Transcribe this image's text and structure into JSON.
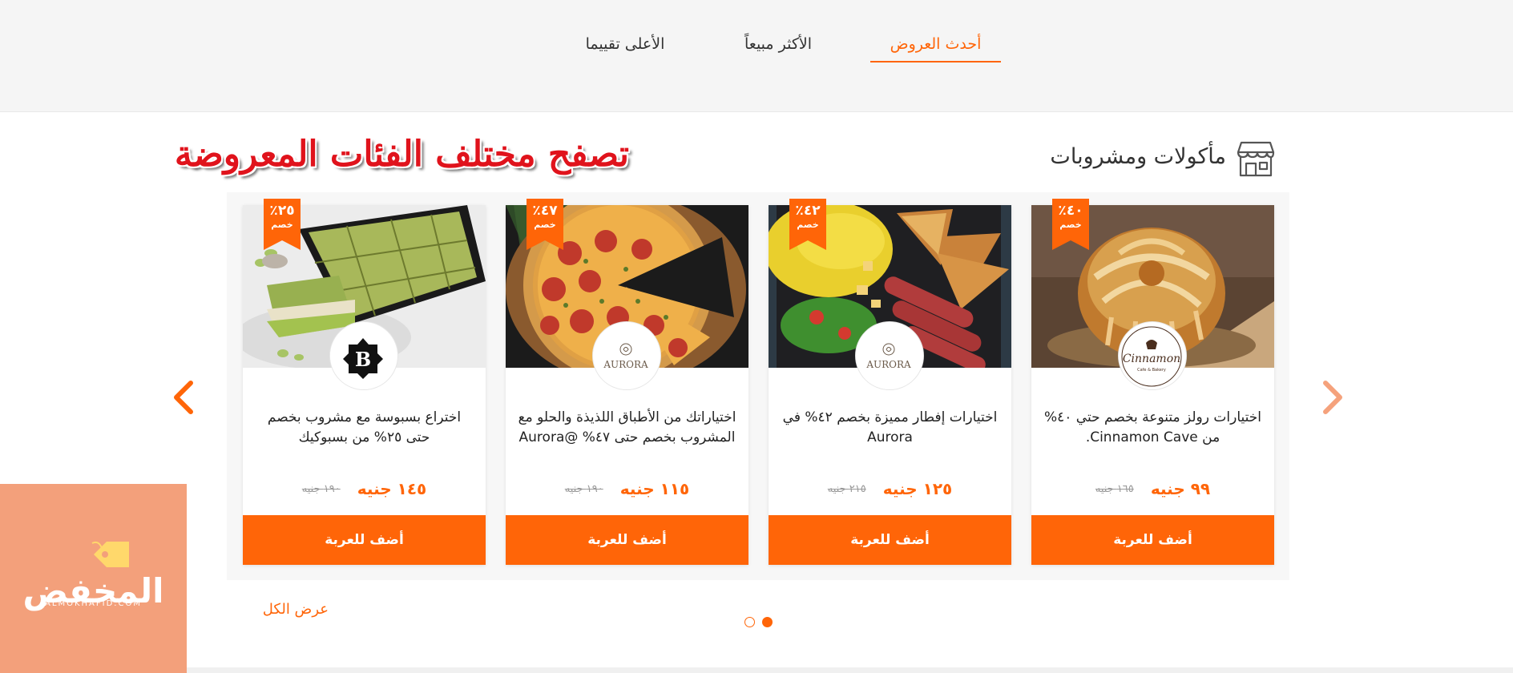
{
  "tabs": [
    {
      "label": "أحدث العروض",
      "active": true
    },
    {
      "label": "الأكثر مبيعاً",
      "active": false
    },
    {
      "label": "الأعلى تقييما",
      "active": false
    }
  ],
  "section": {
    "title": "مأكولات ومشروبات",
    "icon": "store-icon"
  },
  "promo_heading": "تصفح مختلف الفئات المعروضة",
  "badge_word": "خصم",
  "add_to_cart_label": "أضف للعربة",
  "cards": [
    {
      "title": "اختيارات رولز متنوعة بخصم حتي ٤٠% من Cinnamon Cave.",
      "discount": "٤٠٪",
      "price_new": "٩٩ جنيه",
      "price_old": "١٦٥ جنيه",
      "brand": "Cinnamon Cave",
      "brand_logo_text": "Cinnamon",
      "brand_logo_sub": "Cafe & Bakery",
      "image": "cinnamon-roll"
    },
    {
      "title": "اختيارات إفطار مميزة بخصم ٤٢% في Aurora",
      "discount": "٤٢٪",
      "price_new": "١٢٥ جنيه",
      "price_old": "٢١٥ جنيه",
      "brand": "Aurora",
      "brand_logo_text": "AURORA",
      "image": "breakfast-plate"
    },
    {
      "title": "اختياراتك من الأطباق اللذيذة والحلو مع المشروب بخصم حتى ٤٧% @Aurora",
      "discount": "٤٧٪",
      "price_new": "١١٥ جنيه",
      "price_old": "١٩٠ جنيه",
      "brand": "Aurora",
      "brand_logo_text": "AURORA",
      "image": "pepperoni-pizza"
    },
    {
      "title": "اختراع بسبوسة مع مشروب بخصم حتى ٢٥% من بسبوكيك",
      "discount": "٢٥٪",
      "price_new": "١٤٥ جنيه",
      "price_old": "١٩٠ جنيه",
      "brand": "بسبوكيك",
      "brand_logo_text": "B",
      "image": "pistachio-basbousa"
    }
  ],
  "view_all_label": "عرض الكل",
  "pagination": {
    "pages": 2,
    "current": 1
  },
  "watermark": {
    "text": "المخفض",
    "url": "ALMOKHAFID.COM"
  },
  "colors": {
    "accent": "#ff6508",
    "promo_red": "#e0131c",
    "watermark_bg": "#f3a07b"
  }
}
